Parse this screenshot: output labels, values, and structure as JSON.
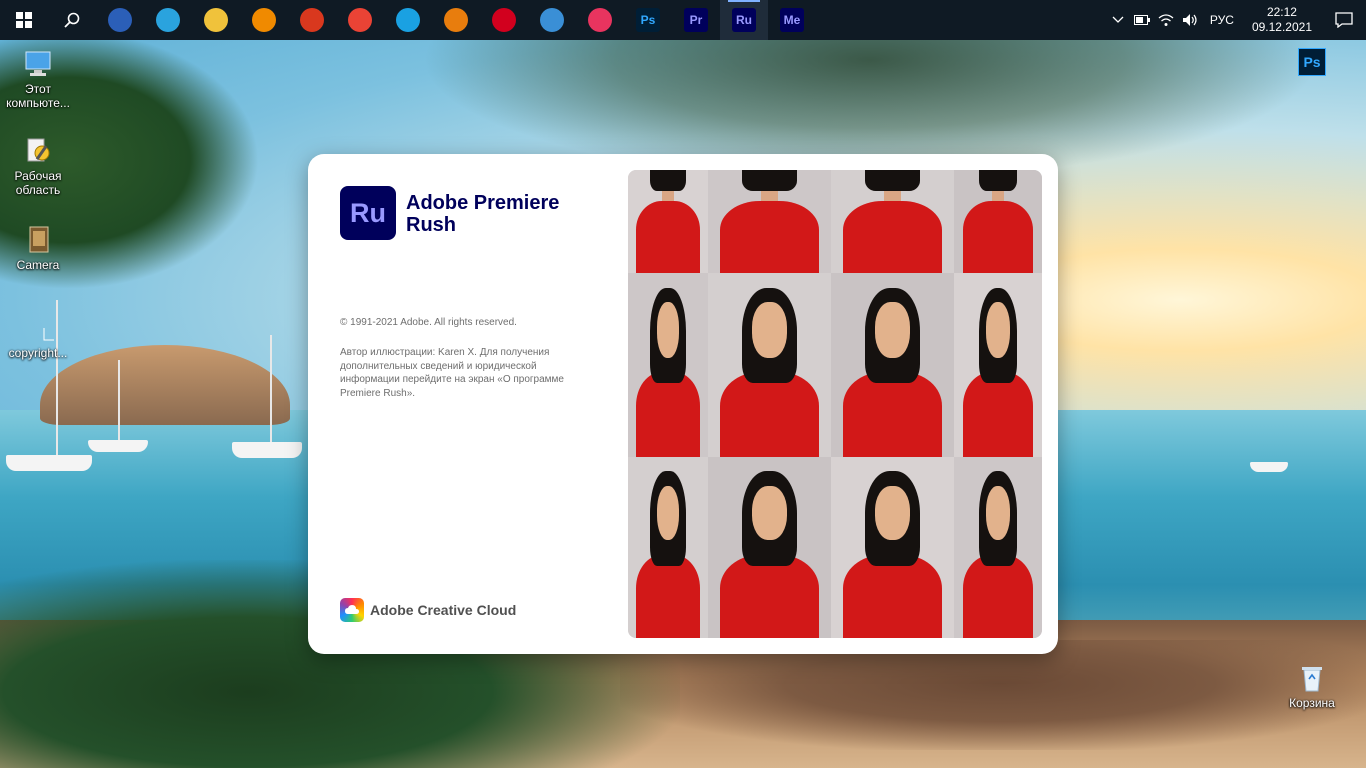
{
  "taskbar": {
    "start_icon": "windows-start-icon",
    "search_icon": "search-icon",
    "pinned": [
      {
        "name": "pocket-icon",
        "bg": "#2b5fb8",
        "fg": "#ffffff",
        "text": ""
      },
      {
        "name": "telegram-icon",
        "bg": "#2aa3de",
        "fg": "#ffffff",
        "text": ""
      },
      {
        "name": "file-explorer-icon",
        "bg": "#f0c23b",
        "fg": "#ffffff",
        "text": ""
      },
      {
        "name": "vlc-icon",
        "bg": "#f08a00",
        "fg": "#ffffff",
        "text": ""
      },
      {
        "name": "phone-app-icon",
        "bg": "#d9381e",
        "fg": "#ffffff",
        "text": ""
      },
      {
        "name": "chrome-icon",
        "bg": "#ea4335",
        "fg": "#ffffff",
        "text": ""
      },
      {
        "name": "edge-icon",
        "bg": "#1aa1e2",
        "fg": "#ffffff",
        "text": ""
      },
      {
        "name": "blender-icon",
        "bg": "#e87d0d",
        "fg": "#ffffff",
        "text": ""
      },
      {
        "name": "acrobat-icon",
        "bg": "#d2001e",
        "fg": "#ffffff",
        "text": ""
      },
      {
        "name": "control-panel-icon",
        "bg": "#3a8fd6",
        "fg": "#ffffff",
        "text": ""
      },
      {
        "name": "creative-cloud-icon",
        "bg": "#e8345f",
        "fg": "#ffffff",
        "text": ""
      },
      {
        "name": "photoshop-icon",
        "bg": "#001e36",
        "fg": "#31a8ff",
        "text": "Ps"
      },
      {
        "name": "premiere-pro-icon",
        "bg": "#00005b",
        "fg": "#9999ff",
        "text": "Pr"
      },
      {
        "name": "premiere-rush-icon",
        "bg": "#00005b",
        "fg": "#9999ff",
        "text": "Ru"
      },
      {
        "name": "media-encoder-icon",
        "bg": "#00005b",
        "fg": "#9999ff",
        "text": "Me"
      }
    ],
    "active_index": 13,
    "tray": {
      "chevron_icon": "chevron-up-icon",
      "battery_icon": "battery-icon",
      "wifi_icon": "wifi-icon",
      "volume_icon": "volume-icon",
      "language": "РУС",
      "time": "22:12",
      "date": "09.12.2021",
      "notification_icon": "notification-icon"
    }
  },
  "desktop": {
    "icons": [
      {
        "label": "Этот компьюте...",
        "icon": "computer-icon"
      },
      {
        "label": "Рабочая область",
        "icon": "workspace-icon"
      },
      {
        "label": "Camera",
        "icon": "camera-file-icon"
      },
      {
        "label": "copyright...",
        "icon": "blank-file-icon"
      },
      {
        "label": "Корзина",
        "icon": "recycle-bin-icon"
      }
    ],
    "ps_shortcut": "Ps"
  },
  "splash": {
    "logo_text": "Ru",
    "product_name": "Adobe Premiere Rush",
    "copyright": "© 1991-2021 Adobe. All rights reserved.",
    "credits": "Автор иллюстрации: Karen X. Для получения дополнительных сведений и юридической информации перейдите на экран «О программе Premiere Rush».",
    "brand": "Adobe Creative Cloud",
    "colors": {
      "rush_dark": "#00005b",
      "rush_accent": "#9999ff",
      "shirt_red": "#d21818"
    }
  }
}
